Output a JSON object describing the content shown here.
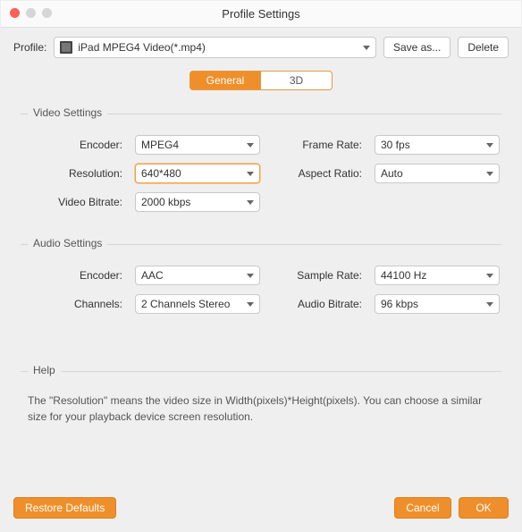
{
  "window": {
    "title": "Profile Settings"
  },
  "profile": {
    "label": "Profile:",
    "selected": "iPad MPEG4 Video(*.mp4)",
    "save_as": "Save as...",
    "delete": "Delete"
  },
  "tabs": {
    "general": "General",
    "three_d": "3D",
    "active": "general"
  },
  "video": {
    "title": "Video Settings",
    "encoder_label": "Encoder:",
    "encoder": "MPEG4",
    "resolution_label": "Resolution:",
    "resolution": "640*480",
    "bitrate_label": "Video Bitrate:",
    "bitrate": "2000 kbps",
    "framerate_label": "Frame Rate:",
    "framerate": "30 fps",
    "aspect_label": "Aspect Ratio:",
    "aspect": "Auto"
  },
  "audio": {
    "title": "Audio Settings",
    "encoder_label": "Encoder:",
    "encoder": "AAC",
    "channels_label": "Channels:",
    "channels": "2 Channels Stereo",
    "samplerate_label": "Sample Rate:",
    "samplerate": "44100 Hz",
    "bitrate_label": "Audio Bitrate:",
    "bitrate": "96 kbps"
  },
  "help": {
    "title": "Help",
    "text": "The \"Resolution\" means the video size in Width(pixels)*Height(pixels).  You can choose a similar size for your playback device screen resolution."
  },
  "footer": {
    "restore": "Restore Defaults",
    "cancel": "Cancel",
    "ok": "OK"
  }
}
